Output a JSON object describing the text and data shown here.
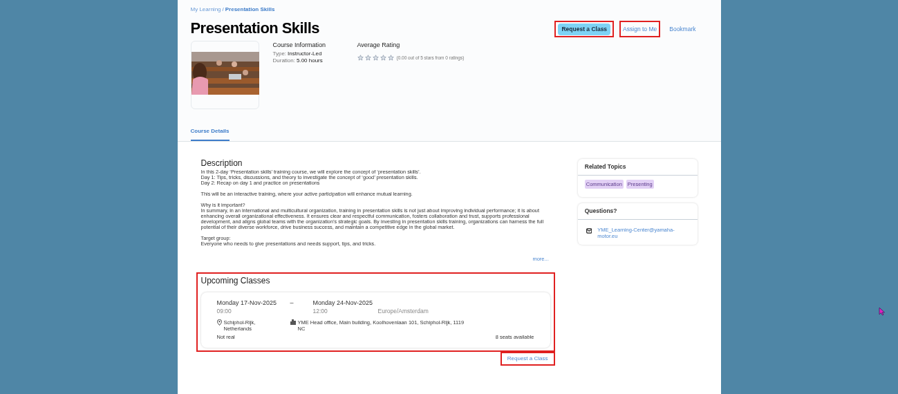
{
  "breadcrumb": [
    {
      "label": "My Learning",
      "current": false
    },
    {
      "label": "Presentation Skills",
      "current": true
    }
  ],
  "breadcrumb_separator": "/",
  "title": "Presentation Skills",
  "actions": [
    {
      "label": "Request a Class",
      "kind": "primary",
      "highlighted": true
    },
    {
      "label": "Assign to Me",
      "kind": "link",
      "highlighted": true
    },
    {
      "label": "Bookmark",
      "kind": "link",
      "highlighted": false
    }
  ],
  "course_info": {
    "heading": "Course Information",
    "fields": [
      {
        "label": "Type:",
        "value": "Instructor-Led"
      },
      {
        "label": "Duration:",
        "value": "5.00 hours"
      }
    ]
  },
  "rating": {
    "heading": "Average Rating",
    "stars": 0,
    "summary": "(0.00 out of 5 stars from 0 ratings)"
  },
  "tabs": [
    {
      "label": "Course Details",
      "selected": true
    }
  ],
  "description": {
    "heading": "Description",
    "paragraphs": [
      [
        "In this 2-day ‘Presentation skills’ training course, we will explore the concept of ‘presentation skills’.",
        "Day 1: Tips, tricks, discussions, and theory to investigate the concept of ‘good’ presentation skills.",
        "Day 2: Recap on day 1 and practice on presentations"
      ],
      [
        "This will be an interactive training, where your active participation will enhance mutual learning."
      ],
      [
        "Why is it important?",
        "In summary, in an international and multicultural organization, training in presentation skills is not just about improving individual performance; it is about enhancing overall organizational effectiveness. It ensures clear and respectful communication, fosters collaboration and trust, supports professional development, and aligns global teams with the organization’s strategic goals. By investing in presentation skills training, organizations can harness the full potential of their diverse workforce, drive business success, and maintain a competitive edge in the global market."
      ],
      [
        "Target group:",
        "Everyone who needs to give presentations and needs support, tips, and tricks."
      ]
    ],
    "more": "more..."
  },
  "related_topics": {
    "heading": "Related Topics",
    "tags": [
      "Communication",
      "Presenting"
    ]
  },
  "questions": {
    "heading": "Questions?",
    "email": "YME_Learning-Center@yamaha-motor.eu"
  },
  "upcoming": {
    "heading": "Upcoming Classes",
    "highlighted": true,
    "classes": [
      {
        "start_date": "Monday 17-Nov-2025",
        "separator": "–",
        "end_date": "Monday 24-Nov-2025",
        "start_time": "09:00",
        "end_time": "12:00",
        "timezone": "Europe/Amsterdam",
        "location": "Schiphol-Rijk, Netherlands",
        "venue": "YME Head office, Main building, Koolhovenlaan 101, Schiphol-Rijk, 1119 NC",
        "note": "Not real",
        "seats": "8 seats available"
      }
    ]
  },
  "footer_link": {
    "label": "Request a Class",
    "highlighted": true
  }
}
